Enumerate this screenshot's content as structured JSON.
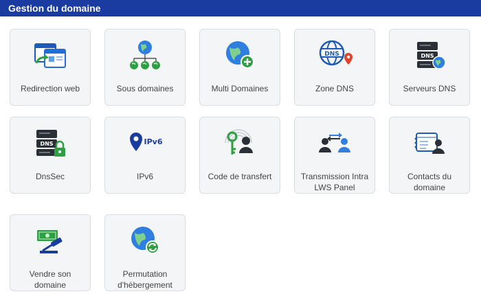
{
  "header": {
    "title": "Gestion du domaine"
  },
  "tiles": [
    {
      "label": "Redirection web",
      "icon": "web-redirect-icon"
    },
    {
      "label": "Sous domaines",
      "icon": "subdomains-globe-icon"
    },
    {
      "label": "Multi Domaines",
      "icon": "globe-add-icon"
    },
    {
      "label": "Zone DNS",
      "icon": "dns-zone-globe-pin-icon"
    },
    {
      "label": "Serveurs DNS",
      "icon": "dns-server-icon"
    },
    {
      "label": "DnsSec",
      "icon": "dnssec-lock-icon"
    },
    {
      "label": "IPv6",
      "icon": "ipv6-pin-icon"
    },
    {
      "label": "Code de transfert",
      "icon": "transfer-code-key-icon"
    },
    {
      "label": "Transmission Intra LWS Panel",
      "icon": "users-transfer-icon"
    },
    {
      "label": "Contacts du domaine",
      "icon": "contact-card-icon"
    },
    {
      "label": "Vendre son domaine",
      "icon": "sell-auction-icon"
    },
    {
      "label": "Permutation d'hébergement",
      "icon": "hosting-swap-globe-icon"
    }
  ],
  "colors": {
    "header_bg": "#1a3ca0",
    "tile_bg": "#f4f5f7",
    "tile_border": "#d9dde2",
    "accent_green": "#2ea043",
    "accent_blue": "#1e6fd9"
  }
}
